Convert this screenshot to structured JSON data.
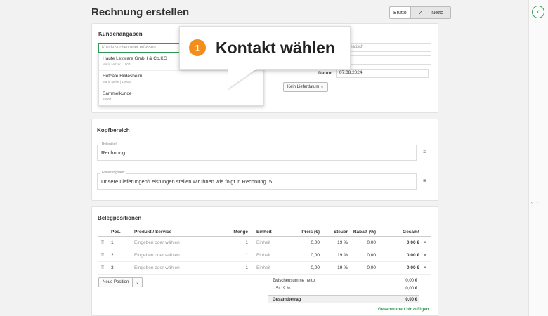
{
  "header": {
    "title": "Rechnung erstellen",
    "brutto_label": "Brutto",
    "netto_label": "Netto"
  },
  "customer": {
    "section_title": "Kundenangaben",
    "search_placeholder": "Kunde suchen oder erfassen",
    "dropdown": [
      {
        "name": "Haufe Lexware GmbH & Co.KG",
        "sub": "Maria Nutzer | 10001"
      },
      {
        "name": "Hofcafé Hildesheim",
        "sub": "Maria Meier | 10005"
      },
      {
        "name": "Sammelkunde",
        "sub": "10004"
      }
    ],
    "auto_text": "automatisch",
    "date_label": "Datum",
    "date_value": "07.08.2024",
    "delivery_button": "Kein Lieferdatum"
  },
  "callout": {
    "number": "1",
    "text": "Kontakt wählen"
  },
  "kopfbereich": {
    "section_title": "Kopfbereich",
    "belegtitel_label": "Belegtitel",
    "belegtitel_value": "Rechnung",
    "einleitung_label": "Einleitungstext",
    "einleitung_value": "Unsere Lieferungen/Leistungen stellen wir Ihnen wie folgt in Rechnung. 5"
  },
  "positions": {
    "section_title": "Belegpositionen",
    "columns": [
      "Pos.",
      "Produkt / Service",
      "Menge",
      "Einheit",
      "Preis (€)",
      "Steuer",
      "Rabatt (%)",
      "Gesamt"
    ],
    "rows": [
      {
        "pos": "1",
        "product": "Eingeben oder wählen",
        "menge": "1",
        "einheit": "Einheit",
        "preis": "0,00",
        "steuer": "19 %",
        "rabatt": "0,00",
        "gesamt": "0,00 €"
      },
      {
        "pos": "2",
        "product": "Eingeben oder wählen",
        "menge": "1",
        "einheit": "Einheit",
        "preis": "0,00",
        "steuer": "19 %",
        "rabatt": "0,00",
        "gesamt": "0,00 €"
      },
      {
        "pos": "3",
        "product": "Eingeben oder wählen",
        "menge": "1",
        "einheit": "Einheit",
        "preis": "0,00",
        "steuer": "19 %",
        "rabatt": "0,00",
        "gesamt": "0,00 €"
      }
    ],
    "new_position_label": "Neue Position",
    "subtotal_label": "Zwischensumme netto",
    "subtotal_value": "0,00 €",
    "tax_label": "USt 19 %",
    "tax_value": "0,00 €",
    "total_label": "Gesamtbetrag",
    "total_value": "0,00 €",
    "discount_link": "Gesamtrabatt hinzufügen"
  },
  "icons": {
    "collapse": "chevron-left-icon",
    "drag": "drag-handle-icon",
    "delete": "close-icon",
    "text_module": "text-module-icon"
  },
  "colors": {
    "accent": "#2e9c55",
    "callout_badge": "#f28e1c"
  }
}
